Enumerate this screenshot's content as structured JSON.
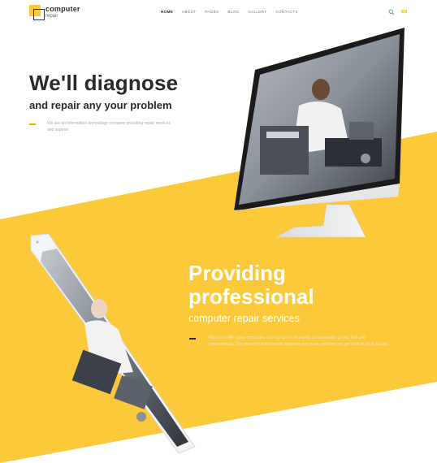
{
  "brand": {
    "name_line1": "computer",
    "name_line2": "repair"
  },
  "nav": {
    "items": [
      {
        "label": "HOME",
        "active": true
      },
      {
        "label": "ABOUT",
        "active": false
      },
      {
        "label": "PAGES",
        "active": false
      },
      {
        "label": "BLOG",
        "active": false
      },
      {
        "label": "GALLERY",
        "active": false
      },
      {
        "label": "CONTACTS",
        "active": false
      }
    ],
    "language": "EN"
  },
  "hero": {
    "title": "We'll diagnose",
    "subtitle": "and repair any your problem",
    "paragraph": "We are an information technology company providing repair services and support"
  },
  "services": {
    "title_line1": "Providing",
    "title_line2": "professional",
    "subtitle": "computer repair services",
    "paragraph": "Welcome! We repair computers and laptops of all brands at reasonable prices, fast and professionally. Our expert technicians will diagnose any issue and help you get back to work quickly."
  },
  "colors": {
    "accent": "#fcc93a",
    "text_dark": "#2a2a2a"
  },
  "icons": {
    "search": "search-icon",
    "logo": "logo-icon"
  }
}
